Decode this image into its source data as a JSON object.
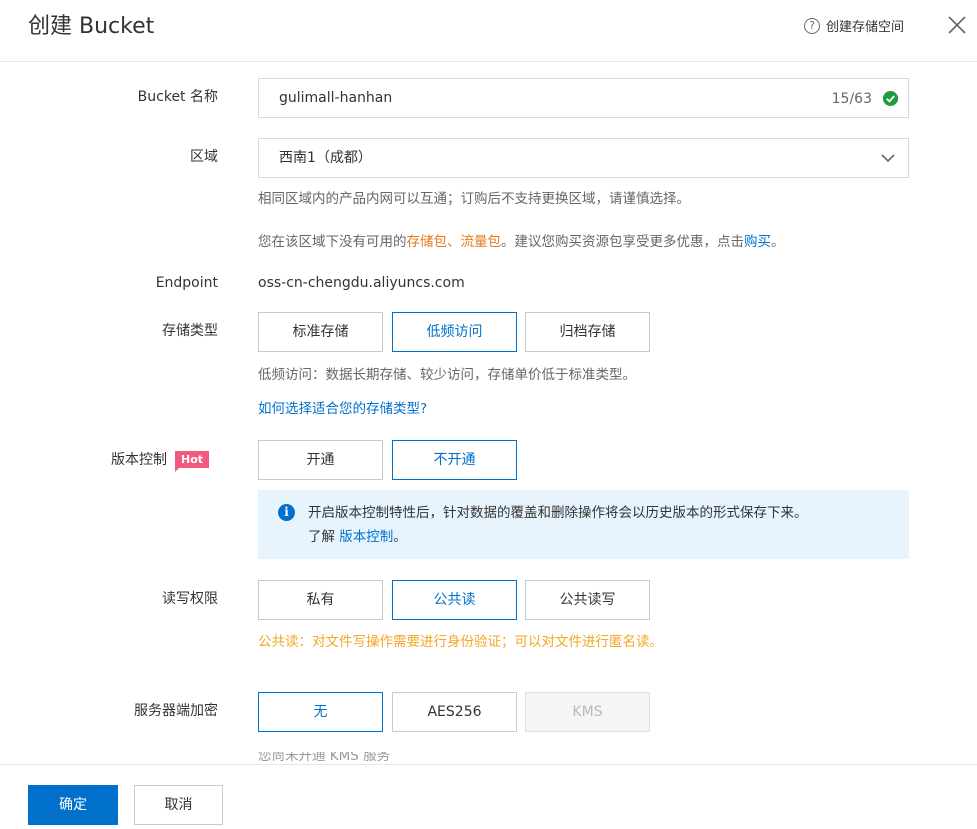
{
  "header": {
    "title": "创建 Bucket",
    "help_link": "创建存储空间",
    "help_icon": "question-circle-icon",
    "close_icon": "close-icon"
  },
  "form": {
    "bucket_name": {
      "label": "Bucket 名称",
      "value": "gulimall-hanhan",
      "counter": "15/63",
      "status_icon": "check-circle-icon"
    },
    "region": {
      "label": "区域",
      "selected": "西南1（成都）",
      "note1": "相同区域内的产品内网可以互通；订购后不支持更换区域，请谨慎选择。",
      "note2_prefix": "您在该区域下没有可用的",
      "note2_highlight": "存储包、流量包",
      "note2_middle": "。建议您购买资源包享受更多优惠，点击",
      "note2_link": "购买",
      "note2_suffix": "。"
    },
    "endpoint": {
      "label": "Endpoint",
      "value": "oss-cn-chengdu.aliyuncs.com"
    },
    "storage_class": {
      "label": "存储类型",
      "options": [
        "标准存储",
        "低频访问",
        "归档存储"
      ],
      "selected": "低频访问",
      "description": "低频访问：数据长期存储、较少访问，存储单价低于标准类型。",
      "help_link": "如何选择适合您的存储类型?"
    },
    "versioning": {
      "label": "版本控制",
      "badge": "Hot",
      "options": [
        "开通",
        "不开通"
      ],
      "selected": "不开通",
      "info_line1": "开启版本控制特性后，针对数据的覆盖和删除操作将会以历史版本的形式保存下来。",
      "info_line2_prefix": "了解",
      "info_line2_link": "版本控制",
      "info_line2_suffix": "。",
      "info_icon": "info-icon"
    },
    "acl": {
      "label": "读写权限",
      "options": [
        "私有",
        "公共读",
        "公共读写"
      ],
      "selected": "公共读",
      "warning": "公共读：对文件写操作需要进行身份验证；可以对文件进行匿名读。"
    },
    "encryption": {
      "label": "服务器端加密",
      "options": [
        "无",
        "AES256",
        "KMS"
      ],
      "selected": "无",
      "disabled": "KMS",
      "note": "您尚未开通 KMS 服务"
    }
  },
  "footer": {
    "confirm": "确定",
    "cancel": "取消"
  },
  "colors": {
    "accent": "#0070cc",
    "highlight": "#e57a1c",
    "warning": "#f5a623",
    "hot_badge": "#f1597f",
    "info_bg": "#e8f4fd",
    "success": "#1f9b3f"
  }
}
